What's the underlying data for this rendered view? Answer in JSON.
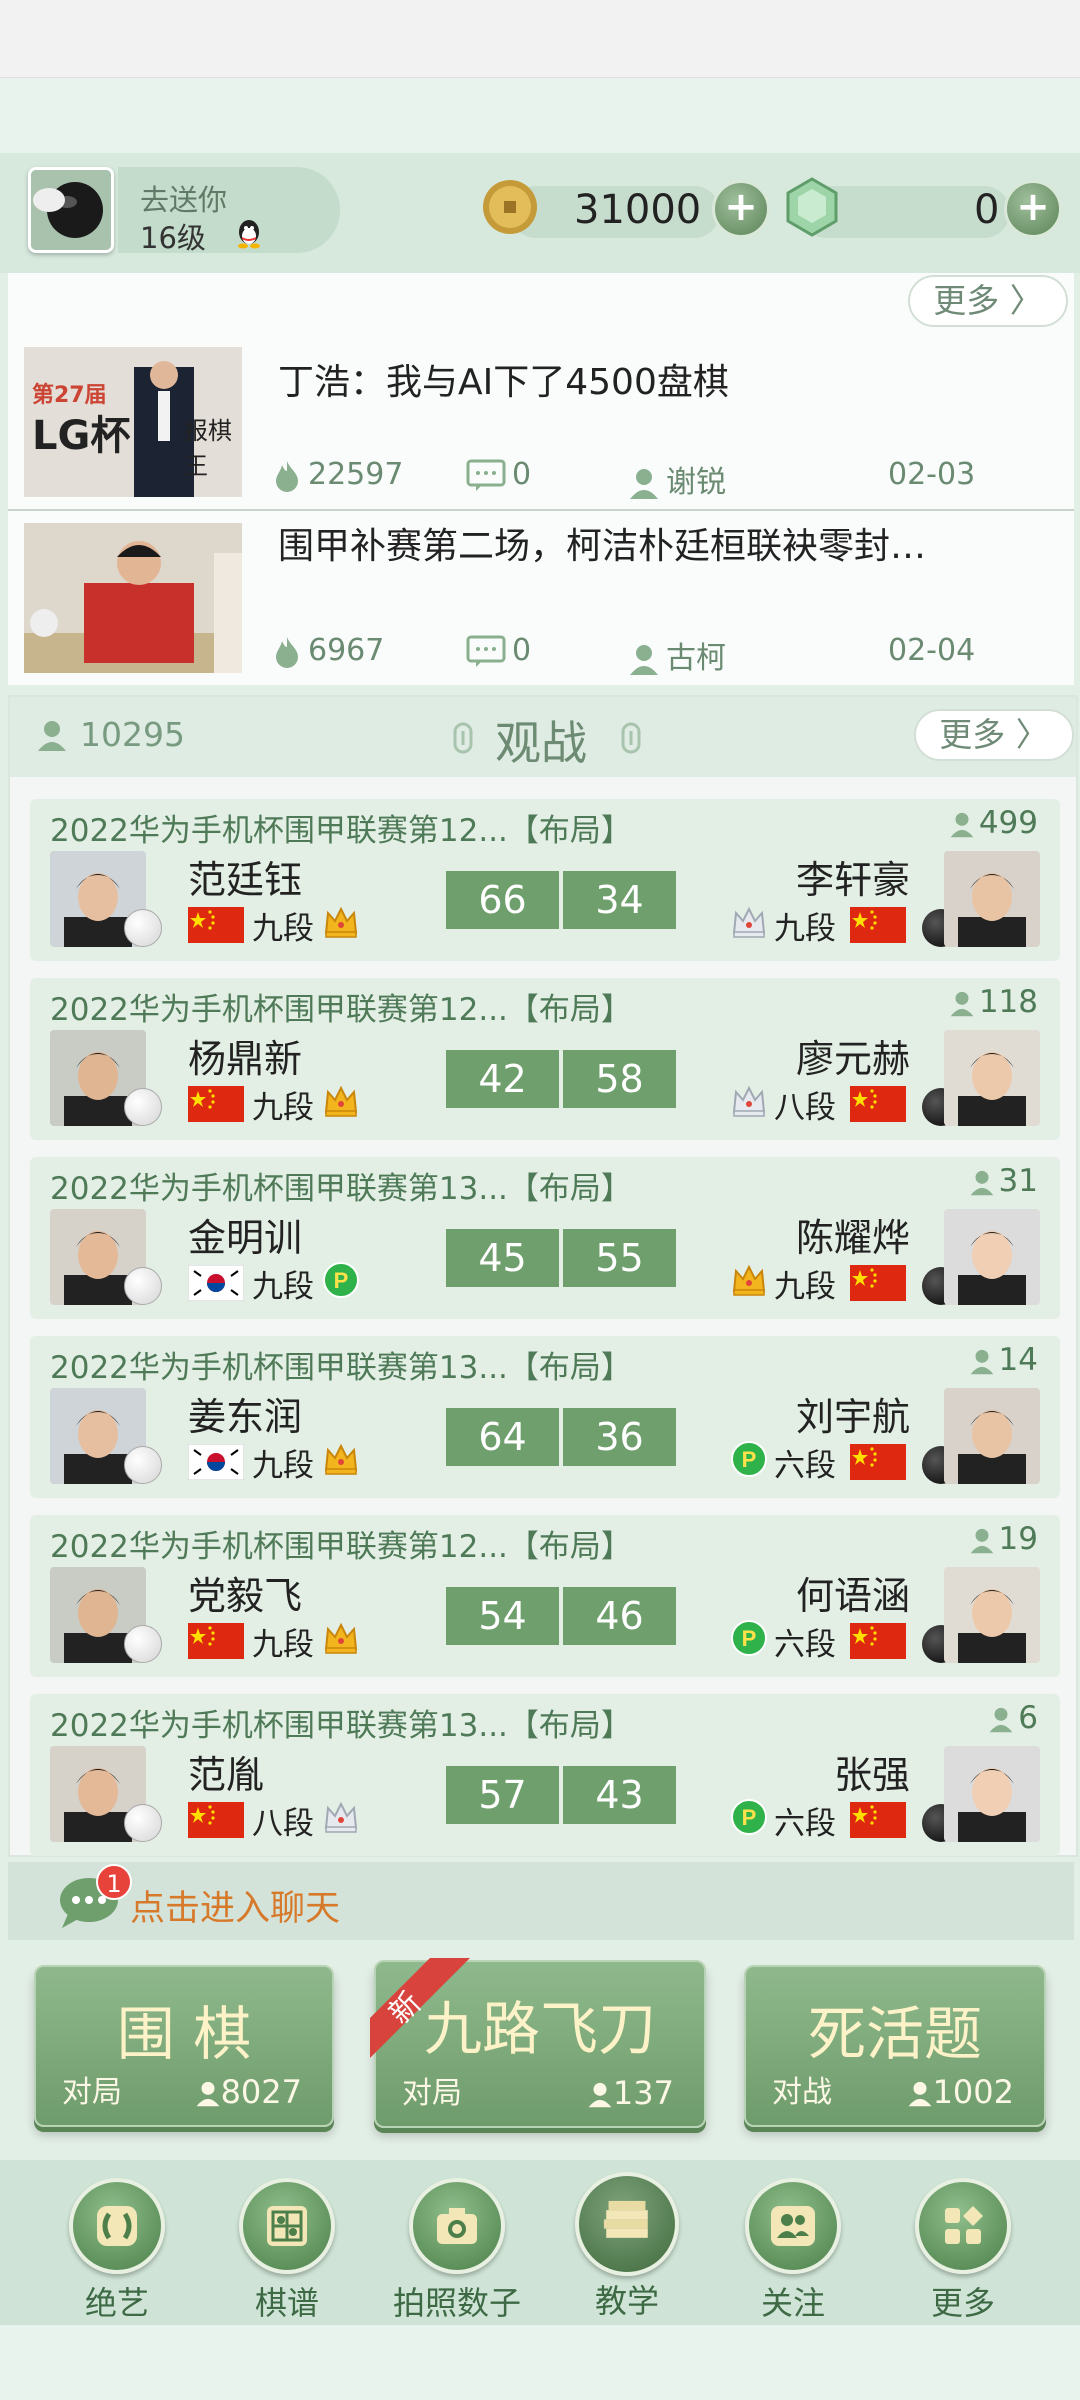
{
  "user": {
    "name": "去送你",
    "level": "16级"
  },
  "currency": {
    "coins": "31000",
    "gems": "0",
    "plus": "+"
  },
  "news": {
    "more_label": "更多 〉",
    "items": [
      {
        "title": "丁浩：我与AI下了4500盘棋",
        "hot": "22597",
        "comments": "0",
        "author": "谢锐",
        "date": "02-03",
        "thumb_text_1": "第27届",
        "thumb_text_2": "LG杯",
        "thumb_text_3": "报棋王"
      },
      {
        "title": "围甲补赛第二场，柯洁朴廷桓联袂零封…",
        "hot": "6967",
        "comments": "0",
        "author": "古柯",
        "date": "02-04"
      }
    ]
  },
  "watch": {
    "count": "10295",
    "title": "观战",
    "more_label": "更多 〉",
    "games": [
      {
        "title": "2022华为手机杯围甲联赛第12...【布局】",
        "viewers": "499",
        "left": {
          "name": "范廷钰",
          "rank": "九段",
          "flag": "cn",
          "badge": "crown"
        },
        "right": {
          "name": "李轩豪",
          "rank": "九段",
          "flag": "cn",
          "badge": "silver-crown"
        },
        "score_left": "66",
        "score_right": "34"
      },
      {
        "title": "2022华为手机杯围甲联赛第12...【布局】",
        "viewers": "118",
        "left": {
          "name": "杨鼎新",
          "rank": "九段",
          "flag": "cn",
          "badge": "crown"
        },
        "right": {
          "name": "廖元赫",
          "rank": "八段",
          "flag": "cn",
          "badge": "silver-crown"
        },
        "score_left": "42",
        "score_right": "58"
      },
      {
        "title": "2022华为手机杯围甲联赛第13...【布局】",
        "viewers": "31",
        "left": {
          "name": "金明训",
          "rank": "九段",
          "flag": "kr",
          "badge": "p"
        },
        "right": {
          "name": "陈耀烨",
          "rank": "九段",
          "flag": "cn",
          "badge": "crown"
        },
        "score_left": "45",
        "score_right": "55"
      },
      {
        "title": "2022华为手机杯围甲联赛第13...【布局】",
        "viewers": "14",
        "left": {
          "name": "姜东润",
          "rank": "九段",
          "flag": "kr",
          "badge": "crown"
        },
        "right": {
          "name": "刘宇航",
          "rank": "六段",
          "flag": "cn",
          "badge": "p"
        },
        "score_left": "64",
        "score_right": "36"
      },
      {
        "title": "2022华为手机杯围甲联赛第12...【布局】",
        "viewers": "19",
        "left": {
          "name": "党毅飞",
          "rank": "九段",
          "flag": "cn",
          "badge": "crown"
        },
        "right": {
          "name": "何语涵",
          "rank": "六段",
          "flag": "cn",
          "badge": "p"
        },
        "score_left": "54",
        "score_right": "46"
      },
      {
        "title": "2022华为手机杯围甲联赛第13...【布局】",
        "viewers": "6",
        "left": {
          "name": "范胤",
          "rank": "八段",
          "flag": "cn",
          "badge": "silver-crown"
        },
        "right": {
          "name": "张强",
          "rank": "六段",
          "flag": "cn",
          "badge": "p"
        },
        "score_left": "57",
        "score_right": "43"
      }
    ]
  },
  "chat": {
    "label": "点击进入聊天",
    "unread": "1"
  },
  "modes": [
    {
      "title": "围 棋",
      "sub": "对局",
      "count": "8027"
    },
    {
      "title": "九路飞刀",
      "sub": "对局",
      "count": "137",
      "ribbon": "新"
    },
    {
      "title": "死活题",
      "sub": "对战",
      "count": "1002"
    }
  ],
  "nav": [
    {
      "label": "绝艺",
      "icon": "jueyi-icon"
    },
    {
      "label": "棋谱",
      "icon": "board-icon"
    },
    {
      "label": "拍照数子",
      "icon": "camera-icon"
    },
    {
      "label": "教学",
      "icon": "books-icon"
    },
    {
      "label": "关注",
      "icon": "users-icon"
    },
    {
      "label": "更多",
      "icon": "grid-icon"
    }
  ],
  "colors": {
    "accent": "#6f9f6d",
    "bg": "#e2efe6",
    "chat_text": "#d7792a",
    "ribbon": "#d8433d"
  }
}
